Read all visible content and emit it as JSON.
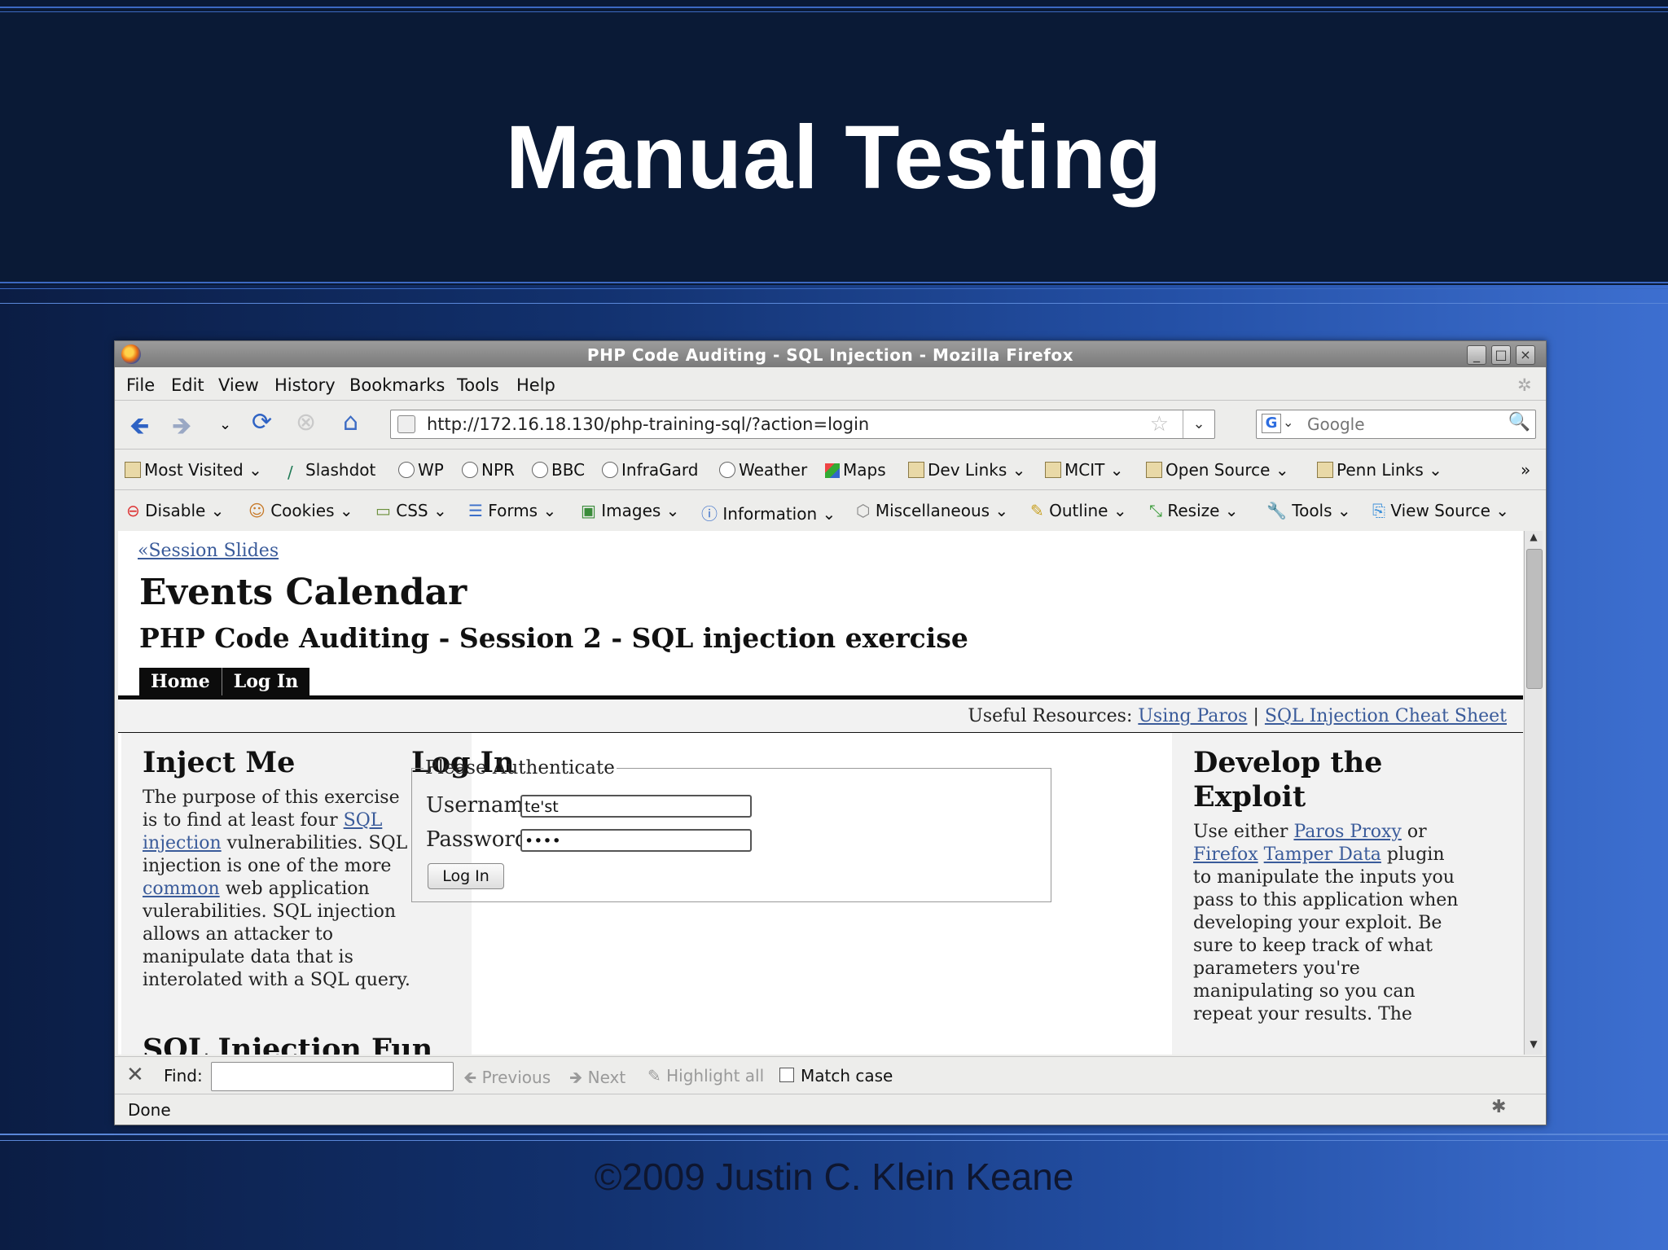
{
  "slide": {
    "title": "Manual Testing",
    "footer": "©2009 Justin C. Klein Keane"
  },
  "window": {
    "title": "PHP Code Auditing - SQL Injection - Mozilla Firefox"
  },
  "menu": [
    "File",
    "Edit",
    "View",
    "History",
    "Bookmarks",
    "Tools",
    "Help"
  ],
  "nav": {
    "url": "http://172.16.18.130/php-training-sql/?action=login",
    "search_placeholder": "Google"
  },
  "bookmarks": [
    "Most Visited",
    "Slashdot",
    "WP",
    "NPR",
    "BBC",
    "InfraGard",
    "Weather",
    "Maps",
    "Dev Links",
    "MCIT",
    "Open Source",
    "Penn Links",
    "»"
  ],
  "webdev_toolbar": [
    "Disable",
    "Cookies",
    "CSS",
    "Forms",
    "Images",
    "Information",
    "Miscellaneous",
    "Outline",
    "Resize",
    "Tools",
    "View Source"
  ],
  "page": {
    "breadcrumb": "«Session Slides",
    "heading": "Events Calendar",
    "subheading": "PHP Code Auditing - Session 2 - SQL injection exercise",
    "tabs": [
      "Home",
      "Log In"
    ],
    "resources_label": "Useful Resources:",
    "resources_links": [
      "Using Paros",
      "SQL Injection Cheat Sheet"
    ],
    "resources_sep": "|",
    "left": {
      "title": "Inject Me",
      "p1": "The purpose of this exercise",
      "p2": "is to find at least four",
      "link1": "SQL",
      "link2": "injection",
      "p3": "vulnerabilities. SQL",
      "p4": "injection is one of the more",
      "link3": "common",
      "p5": "web application",
      "p6": "vulerabilities. SQL injection",
      "p7": "allows an attacker to",
      "p8": "manipulate data that is",
      "p9": "interolated with a SQL query.",
      "next_title": "SQL Injection Fun"
    },
    "center": {
      "title": "Log In",
      "legend": "Please Authenticate",
      "username_label": "Username:",
      "username_value": "te'st",
      "password_label": "Password:",
      "password_value": "••••",
      "login_button": "Log In"
    },
    "right": {
      "title1": "Develop the",
      "title2": "Exploit",
      "l1a": "Use either",
      "link_paros": "Paros Proxy",
      "l1b": "or",
      "link_firefox": "Firefox",
      "link_tamper": "Tamper Data",
      "l2b": "plugin",
      "l3": "to manipulate the inputs you",
      "l4": "pass to this application when",
      "l5": "developing your exploit. Be",
      "l6": "sure to keep track of what",
      "l7": "parameters you're",
      "l8": "manipulating so you can",
      "l9": "repeat your results. The"
    }
  },
  "findbar": {
    "label": "Find:",
    "previous": "Previous",
    "next": "Next",
    "highlight": "Highlight all",
    "match_case": "Match case"
  },
  "status": "Done"
}
